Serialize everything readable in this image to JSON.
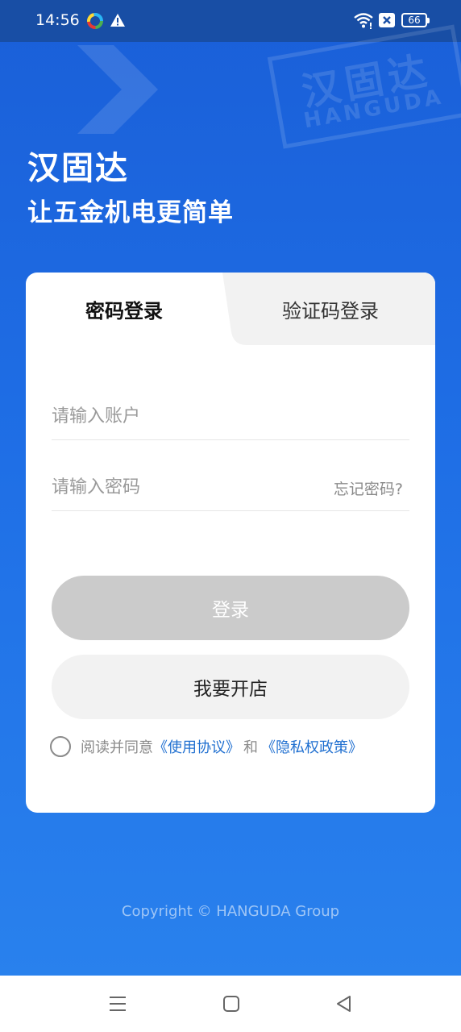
{
  "status_bar": {
    "time": "14:56",
    "battery": "66",
    "icons": [
      "app-icon",
      "warning-icon",
      "wifi-icon",
      "no-sim-icon",
      "battery-icon"
    ]
  },
  "decoration": {
    "stamp_text": "汉固达",
    "stamp_sub": "HANGUDA"
  },
  "header": {
    "title": "汉固达",
    "slogan": "让五金机电更简单"
  },
  "login_card": {
    "tabs": [
      {
        "label": "密码登录",
        "active": true
      },
      {
        "label": "验证码登录",
        "active": false
      }
    ],
    "account_field": {
      "value": "",
      "placeholder": "请输入账户"
    },
    "password_field": {
      "value": "",
      "placeholder": "请输入密码"
    },
    "forgot_password": "忘记密码?",
    "login_button": "登录",
    "open_store_button": "我要开店",
    "agreement": {
      "prefix": "阅读并同意",
      "terms_link": "《使用协议》",
      "and": "和",
      "privacy_link": "《隐私权政策》",
      "checked": false
    }
  },
  "footer": {
    "copyright": "Copyright © HANGUDA Group"
  },
  "nav_bar": {
    "icons": [
      "menu-icon",
      "home-icon",
      "back-icon"
    ]
  },
  "colors": {
    "primary": "#1f6fe6",
    "link": "#1f6fd0",
    "login_disabled": "#cbcbcb",
    "status_bar": "#184ea5"
  }
}
